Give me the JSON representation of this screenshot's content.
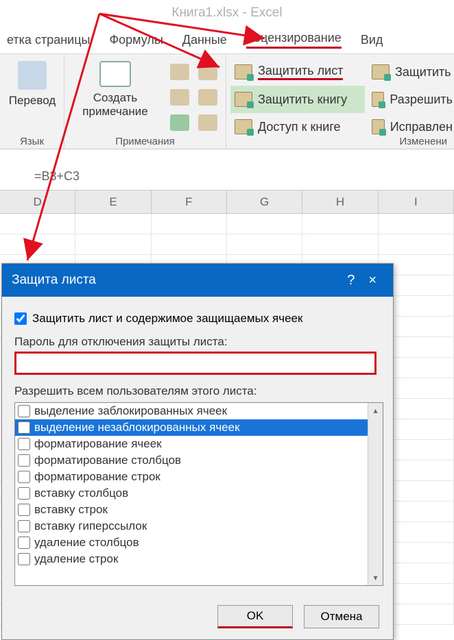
{
  "title": "Книга1.xlsx - Excel",
  "tabs": {
    "t0": "етка страницы",
    "t1": "Формулы",
    "t2": "Данные",
    "t3": "Рецензирование",
    "t4": "Вид"
  },
  "ribbon": {
    "g1": {
      "label": "Язык",
      "btn": "Перевод"
    },
    "g2": {
      "label": "Примечания",
      "btn": "Создать\nпримечание"
    },
    "g3": {
      "label": "Изменени",
      "protect_sheet": "Защитить лист",
      "protect_book": "Защитить книгу",
      "share_book": "Доступ к книге",
      "protect2": "Защитить",
      "allow": "Разрешить",
      "fixes": "Исправлен"
    }
  },
  "formula": "=B3+C3",
  "cols": [
    "D",
    "E",
    "F",
    "G",
    "H",
    "I"
  ],
  "dialog": {
    "title": "Защита листа",
    "help": "?",
    "close": "×",
    "chk1": "Защитить лист и содержимое защищаемых ячеек",
    "pw_label": "Пароль для отключения защиты листа:",
    "perm_label": "Разрешить всем пользователям этого листа:",
    "items": [
      "выделение заблокированных ячеек",
      "выделение незаблокированных ячеек",
      "форматирование ячеек",
      "форматирование столбцов",
      "форматирование строк",
      "вставку столбцов",
      "вставку строк",
      "вставку гиперссылок",
      "удаление столбцов",
      "удаление строк"
    ],
    "ok": "OK",
    "cancel": "Отмена"
  }
}
